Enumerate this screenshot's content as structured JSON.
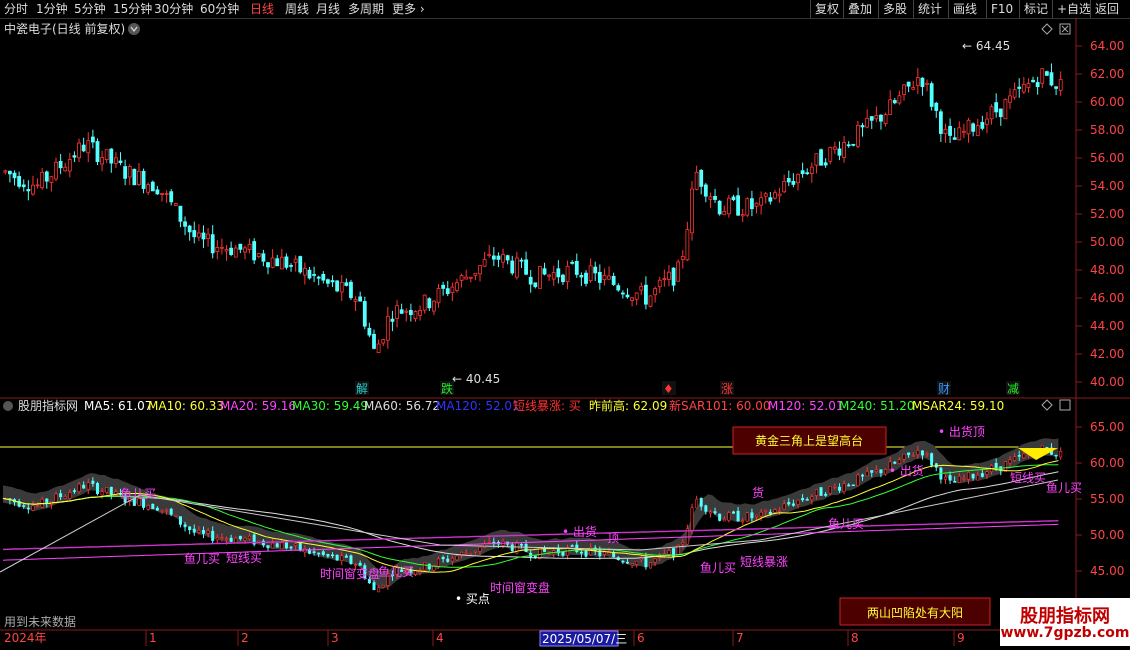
{
  "toolbar": {
    "periods": [
      "分时",
      "1分钟",
      "5分钟",
      "15分钟",
      "30分钟",
      "60分钟",
      "日线",
      "周线",
      "月线",
      "多周期",
      "更多"
    ],
    "active_period": "日线",
    "right_buttons": [
      "复权",
      "叠加",
      "多股",
      "统计",
      "画线",
      "F10",
      "标记",
      "+自选",
      "返回"
    ]
  },
  "main_chart": {
    "title": "中瓷电子(日线 前复权)",
    "y_ticks": [
      "64.00",
      "62.00",
      "60.00",
      "58.00",
      "56.00",
      "54.00",
      "52.00",
      "50.00",
      "48.00",
      "46.00",
      "44.00",
      "42.00",
      "40.00"
    ],
    "high_label": "64.45",
    "low_label": "40.45",
    "event_markers": [
      {
        "text": "解",
        "color": "#22cccc"
      },
      {
        "text": "跌",
        "color": "#22ee22"
      },
      {
        "text": "♦",
        "color": "#ff3333"
      },
      {
        "text": "涨",
        "color": "#ff3333"
      },
      {
        "text": "财",
        "color": "#3399ff"
      },
      {
        "text": "减",
        "color": "#22ee22"
      }
    ]
  },
  "indicator": {
    "title": "股朋指标网",
    "values": [
      {
        "text": "MA5: 61.07",
        "color": "#ffffff"
      },
      {
        "text": "MA10: 60.33",
        "color": "#ffff33"
      },
      {
        "text": "MA20: 59.16",
        "color": "#ff44ff"
      },
      {
        "text": "MA30: 59.49",
        "color": "#33ff33"
      },
      {
        "text": "MA60: 56.72",
        "color": "#dddddd"
      },
      {
        "text": "MA120: 52.01",
        "color": "#3333ff"
      },
      {
        "text": "短线暴涨: 买",
        "color": "#ff3333"
      },
      {
        "text": "昨前高: 62.09",
        "color": "#ffff33"
      },
      {
        "text": "新SAR101: 60.00",
        "color": "#ff4444"
      },
      {
        "text": "M120: 52.01",
        "color": "#ff44ff"
      },
      {
        "text": "M240: 51.20",
        "color": "#33ff33"
      },
      {
        "text": "MSAR24: 59.10",
        "color": "#ffff33"
      }
    ],
    "y_ticks": [
      "65.00",
      "60.00",
      "55.00",
      "50.00",
      "45.00"
    ],
    "box_top": "黄金三角上是望高台",
    "box_bottom": "两山凹陷处有大阳",
    "signals": {
      "buy_point": "买点",
      "time_window": "时间窗变盘",
      "fish_buy": "鱼儿买",
      "ship": "出货",
      "top": "顶",
      "ship_top": "出货顶",
      "short_surge": "短线暴涨",
      "short_buy": "短线买",
      "chuhuo2": "货"
    }
  },
  "footer": {
    "note": "用到未来数据",
    "year": "2024年",
    "months": [
      "1",
      "2",
      "3",
      "4",
      "5",
      "6",
      "7",
      "8",
      "9",
      "1"
    ],
    "cursor_date": "2025/05/07/三"
  },
  "watermark": {
    "line1": "股朋指标网",
    "line2": "www.7gpzb.com"
  },
  "colors": {
    "up": "#ff3333",
    "down": "#54ffff",
    "bg": "#000000",
    "grid": "#8b1a1a"
  }
}
